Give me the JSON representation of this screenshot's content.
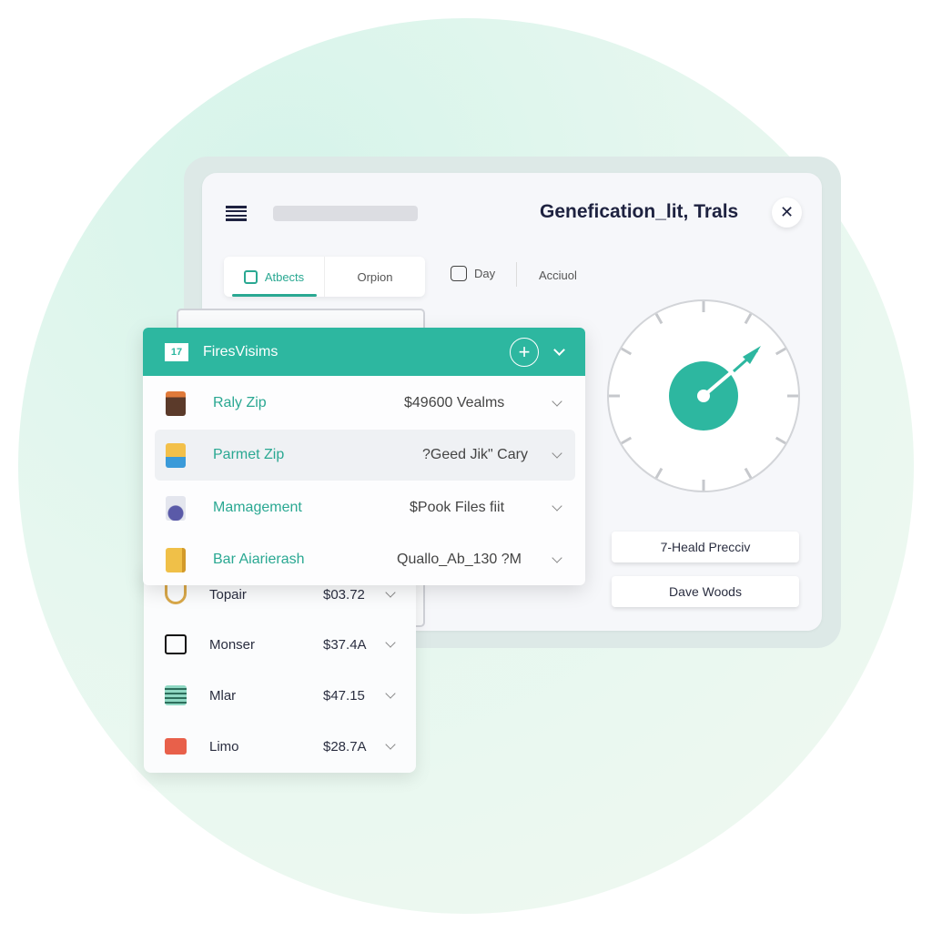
{
  "header": {
    "title": "Genefication_lit, Trals",
    "close_icon": "close-icon",
    "menu_icon": "hamburger-icon"
  },
  "tabs": [
    {
      "label": "Atbects",
      "active": true
    },
    {
      "label": "Orpion"
    }
  ],
  "toolbar": {
    "day_label": "Day",
    "acc_label": "Acciuol"
  },
  "dropdown": {
    "title": "FiresVisims",
    "accent": "#2db7a0",
    "rows": [
      {
        "name": "Raly Zip",
        "value": "$49600 Vealms"
      },
      {
        "name": "Parmet Zip",
        "value": "?Geed Jik\" Cary",
        "highlighted": true
      },
      {
        "name": "Mamagement",
        "value": "$Pook Files fiit"
      },
      {
        "name": "Bar Aiarierash",
        "value": "Quallo_Ab_130 ?M"
      }
    ]
  },
  "lower_list": [
    {
      "name": "Topair",
      "price": "$03.72"
    },
    {
      "name": "Monser",
      "price": "$37.4A"
    },
    {
      "name": "Mlar",
      "price": "$47.15"
    },
    {
      "name": "Limo",
      "price": "$28.7A"
    }
  ],
  "buttons": {
    "primary": "7-Heald Precciv",
    "secondary": "Dave Woods"
  }
}
